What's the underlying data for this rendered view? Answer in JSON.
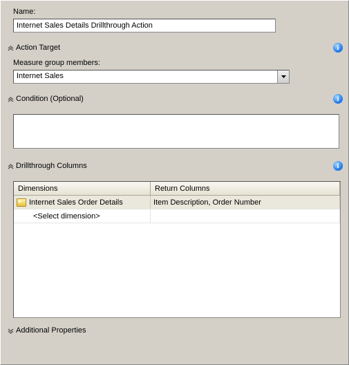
{
  "name_label": "Name:",
  "name_value": "Internet Sales Details Drillthrough Action",
  "sections": {
    "action_target": {
      "title": "Action Target",
      "measure_label": "Measure group members:",
      "measure_value": "Internet Sales"
    },
    "condition": {
      "title": "Condition (Optional)",
      "value": ""
    },
    "drillthrough": {
      "title": "Drillthrough Columns",
      "headers": {
        "dimensions": "Dimensions",
        "return_columns": "Return Columns"
      },
      "rows": [
        {
          "dimension": "Internet Sales Order Details",
          "return_columns": "Item Description, Order Number"
        }
      ],
      "placeholder": "<Select dimension>"
    },
    "additional": {
      "title": "Additional Properties"
    }
  },
  "glyphs": {
    "expand": "«",
    "info": "i"
  }
}
